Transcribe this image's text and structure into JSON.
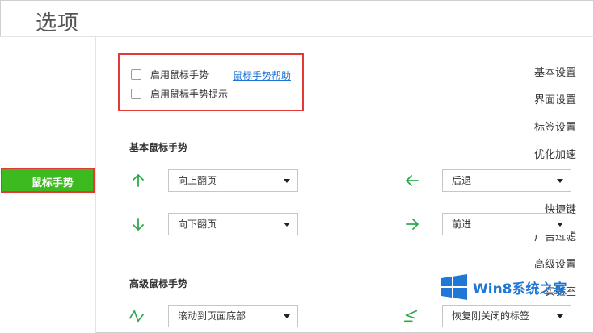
{
  "window": {
    "title": "选项"
  },
  "sidebar": {
    "items": [
      {
        "label": "基本设置"
      },
      {
        "label": "界面设置"
      },
      {
        "label": "标签设置"
      },
      {
        "label": "优化加速"
      },
      {
        "label": "鼠标手势",
        "active": true
      },
      {
        "label": "快捷键"
      },
      {
        "label": "广告过滤"
      },
      {
        "label": "高级设置"
      },
      {
        "label": "实验室"
      }
    ]
  },
  "mouse_gesture_options": {
    "enable_label": "启用鼠标手势",
    "help_link": "鼠标手势帮助",
    "tips_label": "启用鼠标手势提示"
  },
  "basic_section": {
    "title": "基本鼠标手势",
    "up": "向上翻页",
    "left": "后退",
    "down": "向下翻页",
    "right": "前进"
  },
  "advanced_section": {
    "title": "高级鼠标手势",
    "gesture1": "滚动到页面底部",
    "gesture2": "恢复刚关闭的标签"
  },
  "watermark": {
    "text": "Win8系统之家"
  },
  "colors": {
    "accent_green": "#3dba1f",
    "highlight_red": "#e53935",
    "link_blue": "#1e73d8",
    "arrow_green": "#2ea84a"
  }
}
